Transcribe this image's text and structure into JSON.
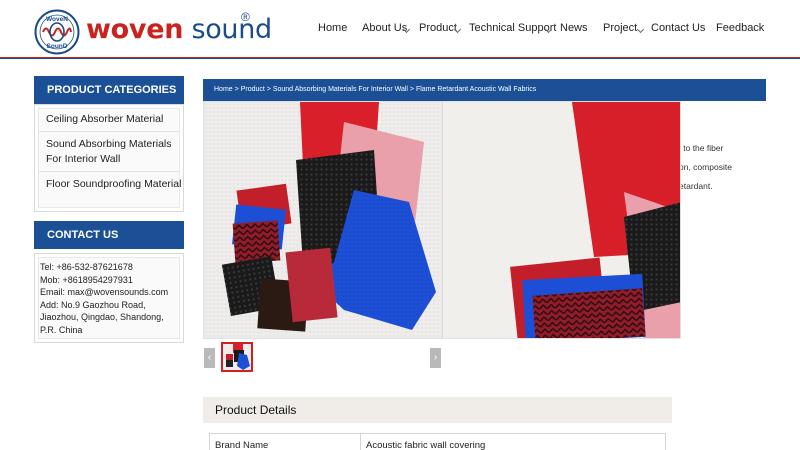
{
  "brand": {
    "logo_text_top": "WoveN",
    "logo_text_bottom": "SounD",
    "name_part1": "woven",
    "name_part2": "sound",
    "registered": "®"
  },
  "nav": {
    "items": [
      {
        "label": "Home",
        "has_dropdown": false
      },
      {
        "label": "About Us",
        "has_dropdown": true
      },
      {
        "label": "Product",
        "has_dropdown": true
      },
      {
        "label": "Technical Support",
        "has_dropdown": true
      },
      {
        "label": "News",
        "has_dropdown": false
      },
      {
        "label": "Project",
        "has_dropdown": true
      },
      {
        "label": "Contact Us",
        "has_dropdown": false
      },
      {
        "label": "Feedback",
        "has_dropdown": false
      }
    ]
  },
  "sidebar": {
    "categories_title": "PRODUCT CATEGORIES",
    "categories": [
      {
        "label_lines": [
          "Ceiling Absorber Material"
        ]
      },
      {
        "label_lines": [
          "Sound Absorbing Materials",
          "For Interior Wall"
        ]
      },
      {
        "label_lines": [
          "Floor Soundproofing Material"
        ]
      }
    ],
    "contact_title": "CONTACT US",
    "contact_lines": [
      "Tel: +86-532-87621678",
      "Mob: +8618954297931",
      "Email: max@wovensounds.com",
      "Add: No.9 Gaozhou Road,",
      "Jiaozhou, Qingdao, Shandong,",
      "P.R. China"
    ]
  },
  "breadcrumb": {
    "items": [
      "Home",
      "Product",
      "Sound Absorbing Materials For Interior Wall",
      "Flame Retardant Acoustic Wall Fabrics"
    ],
    "separator": ">"
  },
  "description_fragments": [
    "l to the fiber",
    "on, composite",
    "etardant."
  ],
  "gallery": {
    "prev_icon": "‹",
    "next_icon": "›"
  },
  "details": {
    "title": "Product Details",
    "rows": [
      {
        "label": "Brand Name",
        "value": "Acoustic fabric wall covering"
      }
    ]
  },
  "colors": {
    "brand_blue": "#1b5097",
    "brand_red": "#c8231f"
  }
}
